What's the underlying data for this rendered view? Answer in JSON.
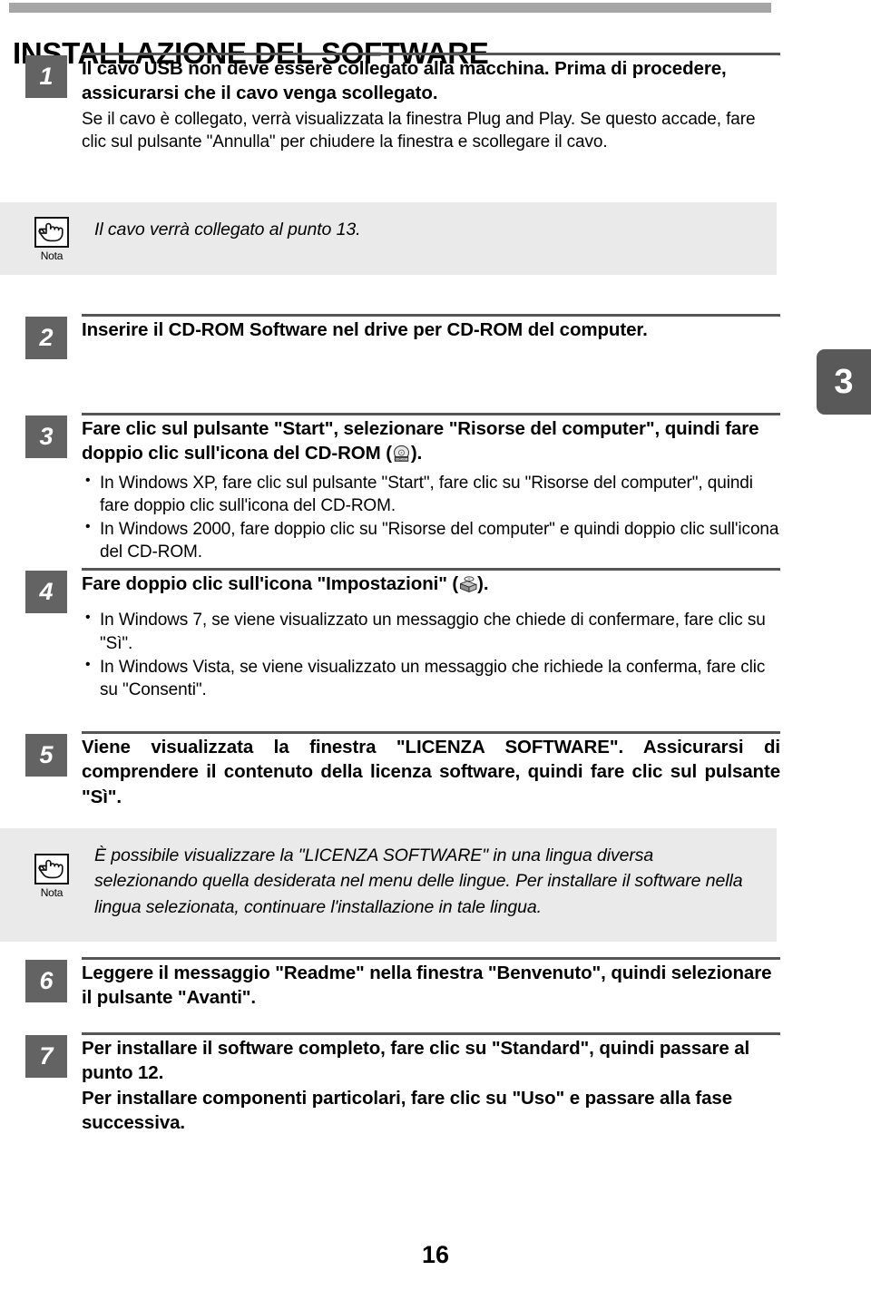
{
  "document": {
    "title": "INSTALLAZIONE DEL SOFTWARE",
    "side_tab": "3",
    "page_number": "16",
    "note_caption": "Nota",
    "colors": {
      "top_bar": "#a6a6a6",
      "step_badge": "#636363",
      "side_tab": "#595959",
      "note_background": "#eaeaea",
      "rule": "#555555",
      "text": "#000000"
    },
    "icons": {
      "note": "pointing-hand-icon",
      "cdrom": "cdrom-disc-icon",
      "setup": "setup-installer-icon"
    }
  },
  "steps": [
    {
      "number": "1",
      "heading": "Il cavo USB non deve essere collegato alla macchina. Prima di procedere, assicurarsi che il cavo venga scollegato.",
      "sub": "Se il cavo è collegato, verrà visualizzata la finestra Plug and Play. Se questo accade, fare clic sul pulsante \"Annulla\" per chiudere la finestra e scollegare il cavo."
    },
    {
      "number": "2",
      "heading": "Inserire il CD-ROM Software nel drive per CD-ROM del computer."
    },
    {
      "number": "3",
      "heading_before_icon": "Fare clic sul pulsante \"Start\", selezionare \"Risorse del computer\", quindi fare doppio clic sull'icona del CD-ROM (",
      "heading_after_icon": ").",
      "bullets": [
        "In Windows XP, fare clic sul pulsante \"Start\", fare clic su \"Risorse del computer\", quindi fare doppio clic sull'icona del CD-ROM.",
        "In Windows 2000, fare doppio clic su \"Risorse del computer\" e quindi doppio clic sull'icona del CD-ROM."
      ]
    },
    {
      "number": "4",
      "heading_before_icon": "Fare doppio clic sull'icona \"Impostazioni\" (",
      "heading_after_icon": ").",
      "bullets": [
        "In Windows 7, se viene visualizzato un messaggio che chiede di confermare, fare clic su \"Sì\".",
        "In Windows Vista, se viene visualizzato un messaggio che richiede la conferma, fare clic su \"Consenti\"."
      ]
    },
    {
      "number": "5",
      "heading": "Viene visualizzata la finestra \"LICENZA SOFTWARE\". Assicurarsi di comprendere il contenuto della licenza software, quindi fare clic sul pulsante \"Sì\"."
    },
    {
      "number": "6",
      "heading": "Leggere il messaggio \"Readme\" nella finestra \"Benvenuto\", quindi selezionare il pulsante \"Avanti\"."
    },
    {
      "number": "7",
      "heading": "Per installare il software completo, fare clic su \"Standard\", quindi passare al punto 12.\nPer installare componenti particolari, fare clic su \"Uso\" e passare alla fase successiva."
    }
  ],
  "notes": [
    {
      "caption": "Nota",
      "text": "Il cavo verrà collegato al punto 13."
    },
    {
      "caption": "Nota",
      "text": "È possibile visualizzare la \"LICENZA SOFTWARE\" in una lingua diversa selezionando quella desiderata nel menu delle lingue. Per installare il software nella lingua selezionata, continuare l'installazione in tale lingua."
    }
  ]
}
